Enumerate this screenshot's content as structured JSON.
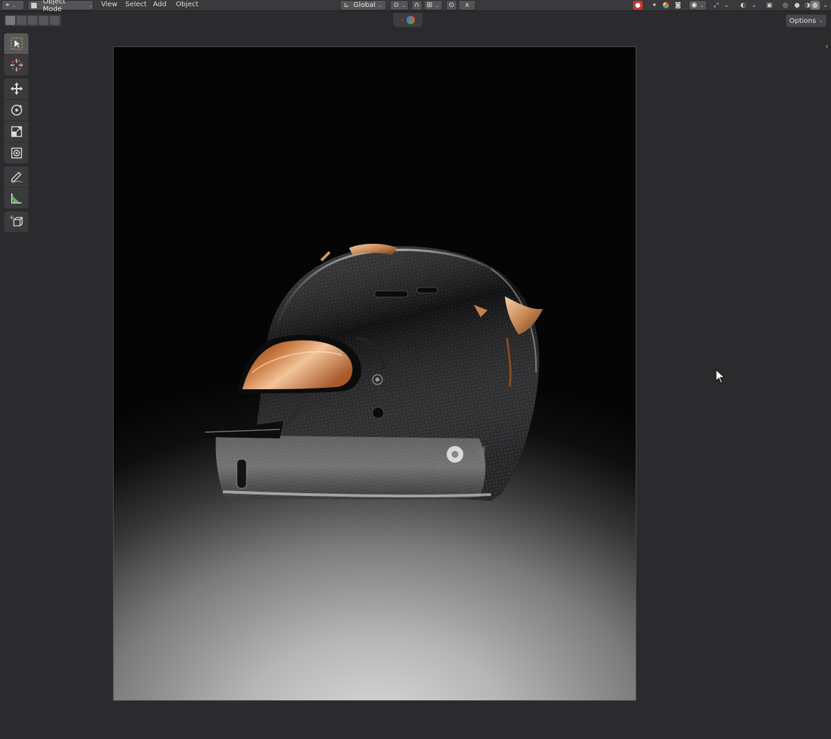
{
  "header": {
    "mode_selector": {
      "label": "Object Mode"
    },
    "menus": [
      "View",
      "Select",
      "Add",
      "Object"
    ],
    "transform_orientation": {
      "label": "Global"
    }
  },
  "tool_settings": {
    "options_label": "Options"
  },
  "toolbar": {
    "groups": [
      [
        "select-box",
        "cursor"
      ],
      [
        "move",
        "rotate",
        "scale",
        "transform"
      ],
      [
        "annotate",
        "measure"
      ],
      [
        "add-cube"
      ]
    ],
    "active_tool": "select-box"
  },
  "viewport": {
    "content": "rendered image of a carbon-fibre racing helmet with an amber visor",
    "colors": {
      "ui_background": "#2b2a2d",
      "header": "#3a3a3d",
      "visor_amber": "#d78a52",
      "carbon_dark": "#1a1a1c"
    }
  }
}
